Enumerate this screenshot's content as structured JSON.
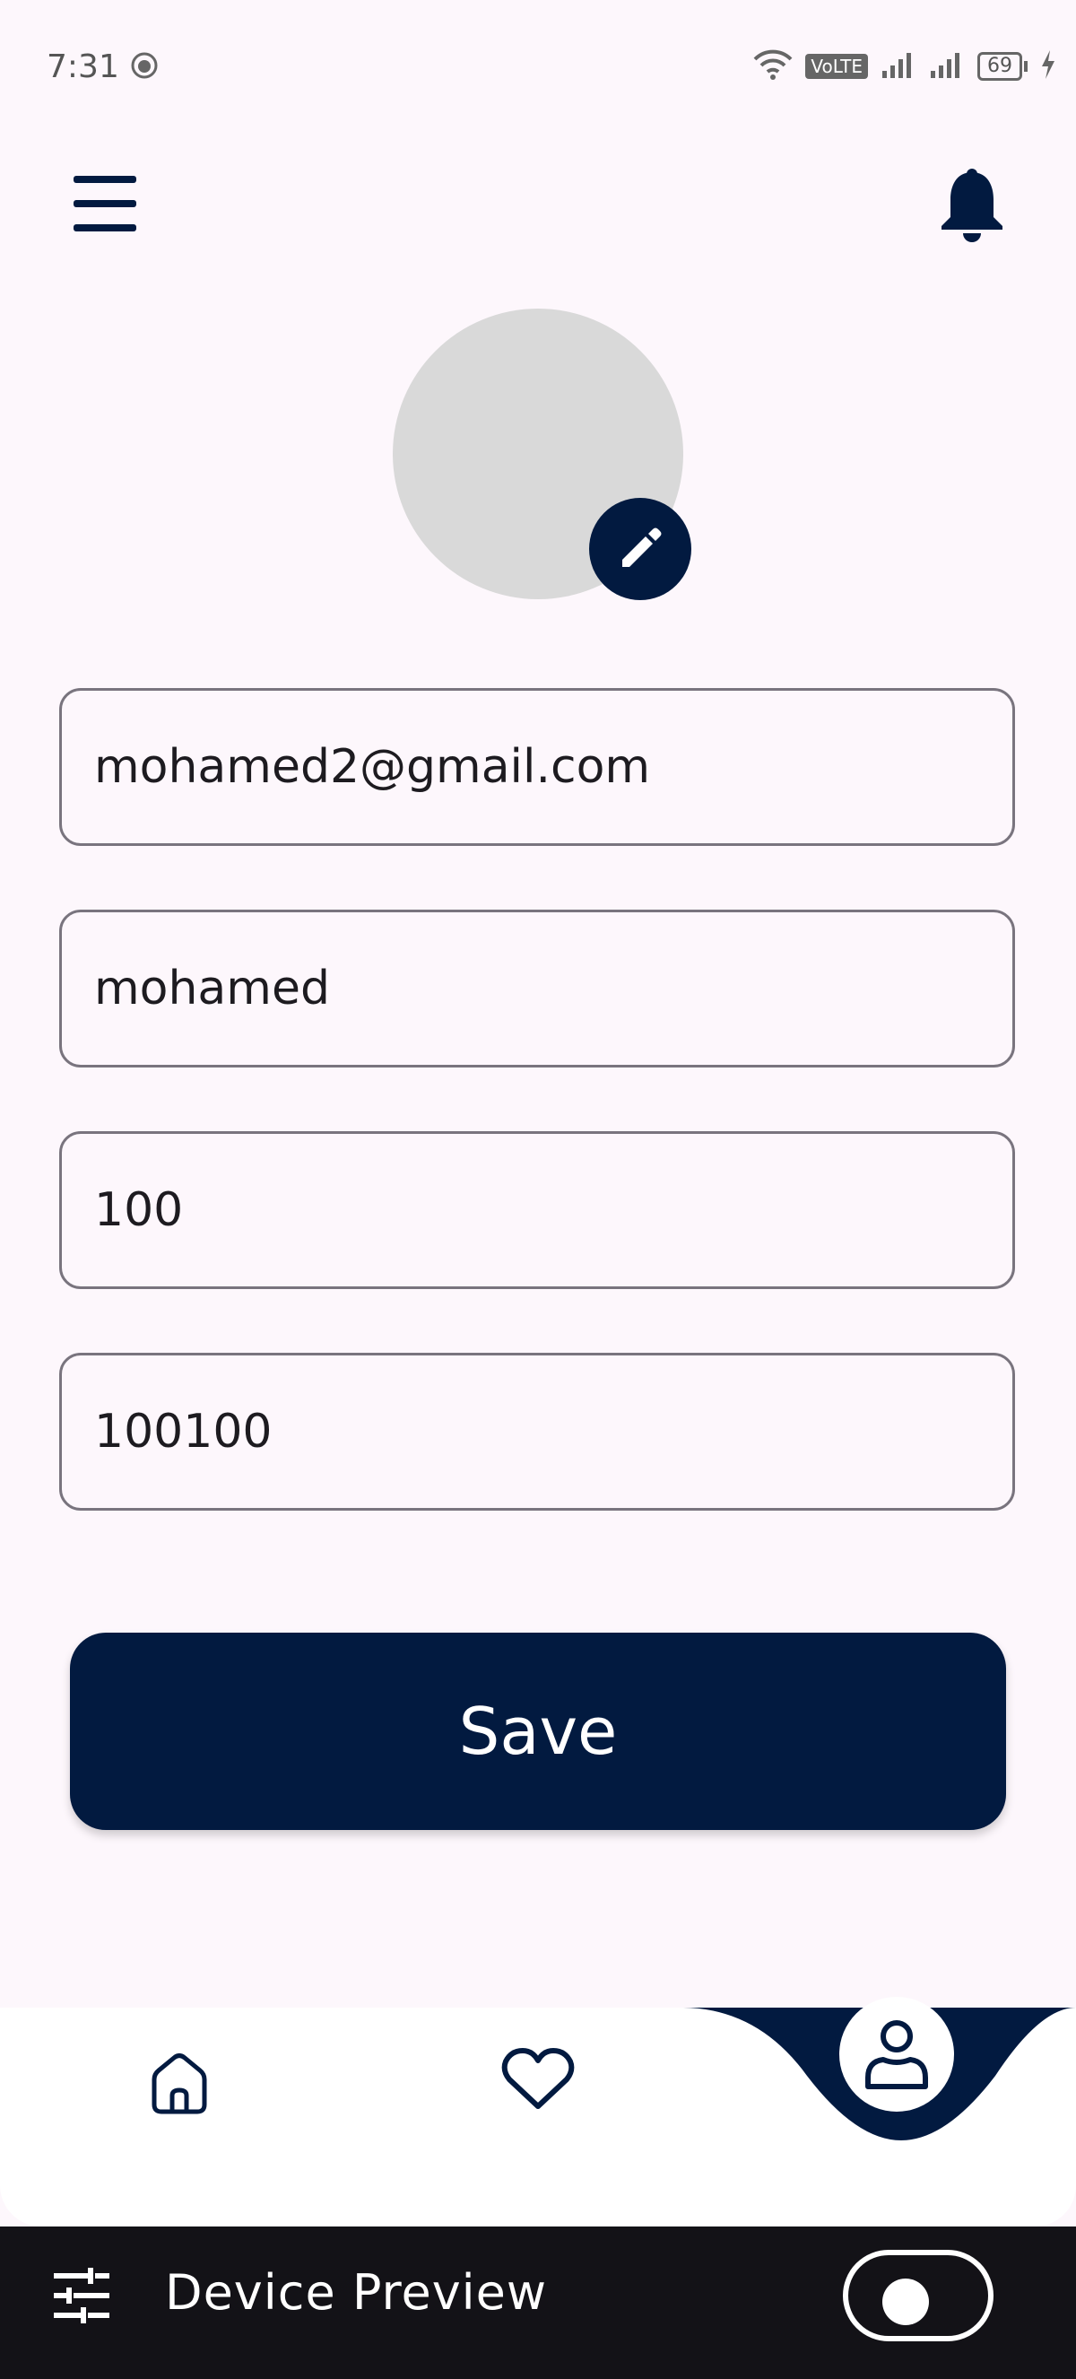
{
  "status_bar": {
    "time": "7:31",
    "volte_label": "VoLTE",
    "battery_level": "69"
  },
  "header": {
    "menu_icon": "menu-icon",
    "notification_icon": "bell-icon"
  },
  "profile": {
    "avatar_icon": "avatar-placeholder",
    "edit_icon": "pencil-icon"
  },
  "form": {
    "email_value": "mohamed2@gmail.com",
    "name_value": "mohamed",
    "field3_value": "100",
    "field4_value": "100100"
  },
  "actions": {
    "save_label": "Save"
  },
  "bottom_nav": {
    "items": [
      {
        "icon": "home-icon",
        "active": false
      },
      {
        "icon": "heart-icon",
        "active": false
      },
      {
        "icon": "person-icon",
        "active": true
      }
    ]
  },
  "device_preview": {
    "label": "Device Preview",
    "icon": "sliders-icon",
    "toggle_on": false
  },
  "colors": {
    "primary": "#021a40",
    "background": "#fdf7fc",
    "avatar_bg": "#d9d9d9",
    "preview_bar": "#131217"
  }
}
